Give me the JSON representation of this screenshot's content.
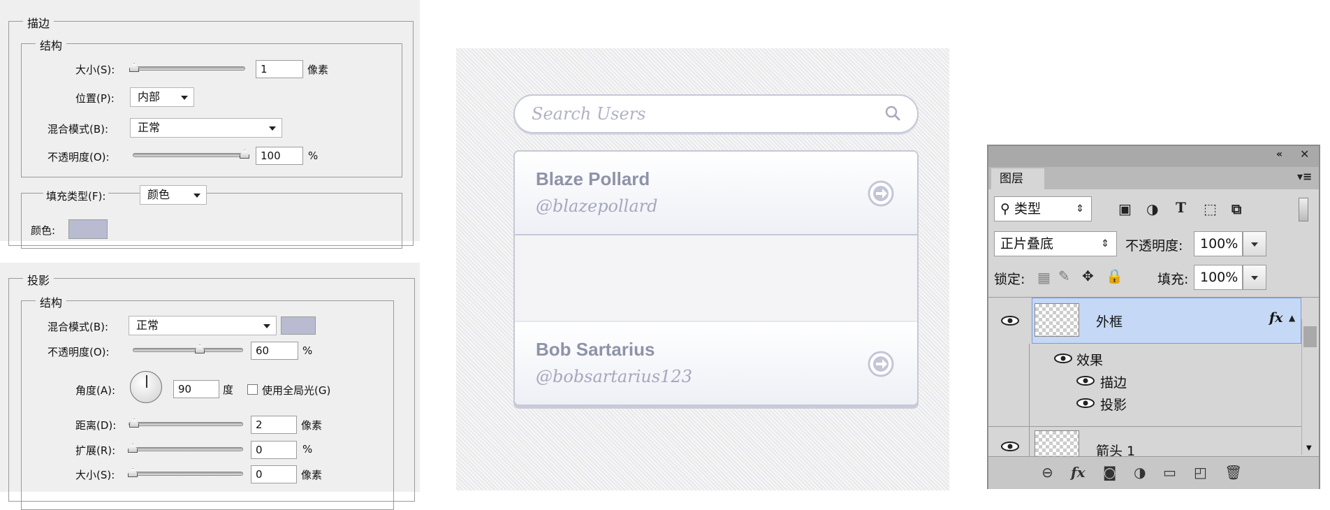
{
  "stroke_panel": {
    "title": "描边",
    "structure_title": "结构",
    "size_label": "大小(S):",
    "size_value": "1",
    "size_unit": "像素",
    "position_label": "位置(P):",
    "position_value": "内部",
    "blend_label": "混合模式(B):",
    "blend_value": "正常",
    "opacity_label": "不透明度(O):",
    "opacity_value": "100",
    "opacity_unit": "%",
    "fill_type_label": "填充类型(F):",
    "fill_type_value": "颜色",
    "color_label": "颜色:",
    "color_swatch": "#b9bcd1"
  },
  "shadow_panel": {
    "title": "投影",
    "structure_title": "结构",
    "blend_label": "混合模式(B):",
    "blend_value": "正常",
    "opacity_label": "不透明度(O):",
    "opacity_value": "60",
    "opacity_unit": "%",
    "angle_label": "角度(A):",
    "angle_value": "90",
    "angle_unit": "度",
    "global_light_label": "使用全局光(G)",
    "distance_label": "距离(D):",
    "distance_value": "2",
    "distance_unit": "像素",
    "spread_label": "扩展(R):",
    "spread_value": "0",
    "spread_unit": "%",
    "size_label": "大小(S):",
    "size_value": "0",
    "size_unit": "像素"
  },
  "mockup": {
    "search_placeholder": "Search Users",
    "users": [
      {
        "name": "Blaze Pollard",
        "handle": "@blazepollard"
      },
      {
        "name": "Bob Sartarius",
        "handle": "@bobsartarius123"
      }
    ]
  },
  "layers_panel": {
    "tab_label": "图层",
    "filter_value": "类型",
    "blend_mode": "正片叠底",
    "opacity_label": "不透明度:",
    "opacity_value": "100%",
    "lock_label": "锁定:",
    "fill_label": "填充:",
    "fill_value": "100%",
    "layers": [
      {
        "name": "外框",
        "fx": "fx"
      },
      {
        "name": "效果"
      },
      {
        "name": "描边"
      },
      {
        "name": "投影"
      },
      {
        "name": "箭头 1"
      }
    ]
  }
}
